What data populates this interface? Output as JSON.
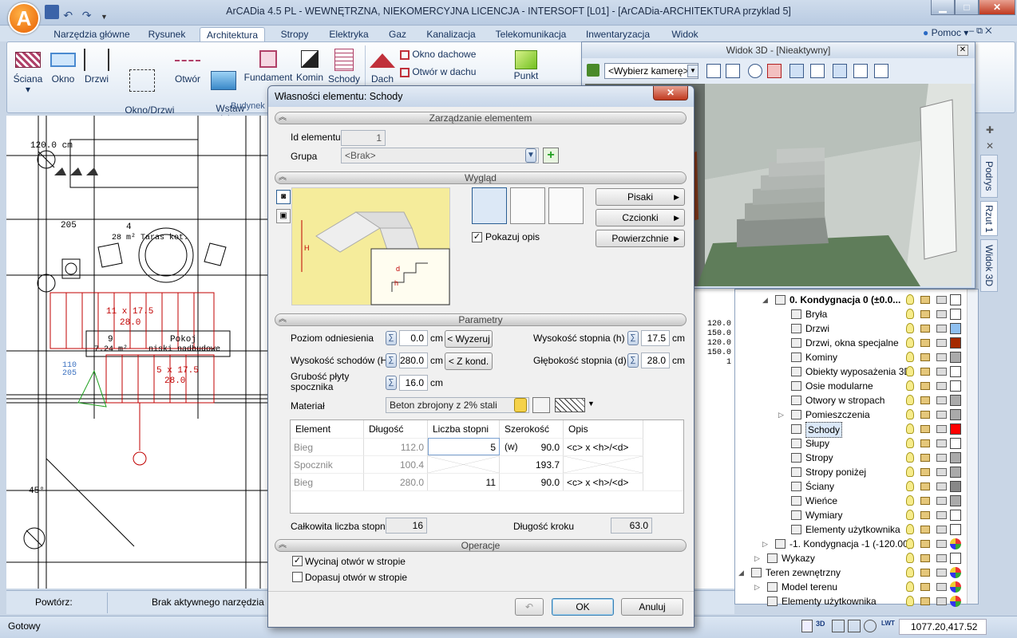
{
  "window": {
    "logo_letter": "A",
    "title": "ArCADia 4.5 PL - WEWNĘTRZNA, NIEKOMERCYJNA LICENCJA - INTERSOFT [L01] - [ArCADia-ARCHITEKTURA przyklad 5]"
  },
  "ribbon_tabs": [
    "Narzędzia główne",
    "Rysunek",
    "Architektura",
    "Stropy",
    "Elektryka",
    "Gaz",
    "Kanalizacja",
    "Telekomunikacja",
    "Inwentaryzacja",
    "Widok"
  ],
  "help_label": "Pomoc",
  "ribbon": {
    "buttons": [
      {
        "label": "Ściana"
      },
      {
        "label": "Okno"
      },
      {
        "label": "Drzwi"
      },
      {
        "label": "Okno/Drzwi\nspecjalne"
      },
      {
        "label": "Otwór"
      },
      {
        "label": "Wstaw\npodciąg"
      },
      {
        "label": "Fundament"
      },
      {
        "label": "Komin"
      },
      {
        "label": "Schody"
      },
      {
        "label": "Dach"
      }
    ],
    "small_buttons": [
      "Okno dachowe",
      "Otwór w dachu"
    ],
    "punkt_label": "Punkt",
    "group_label": "Budynek"
  },
  "view3d": {
    "title": "Widok 3D - [Nieaktywny]",
    "camera_placeholder": "<Wybierz kamerę>"
  },
  "side_tabs": [
    "Podrys",
    "Rzut 1",
    "Widok 3D"
  ],
  "tree": {
    "items": [
      {
        "label": "0. Kondygnacja 0 (±0.0...",
        "bold": true,
        "color": "#ffffff"
      },
      {
        "label": "Bryła",
        "color": "#ffffff"
      },
      {
        "label": "Drzwi",
        "color": "#8fc0f0"
      },
      {
        "label": "Drzwi, okna specjalne",
        "color": "#a52a00"
      },
      {
        "label": "Kominy",
        "color": "#aaaaaa"
      },
      {
        "label": "Obiekty wyposażenia 3D",
        "color": "#ffffff"
      },
      {
        "label": "Osie modularne",
        "color": "#ffffff"
      },
      {
        "label": "Otwory w stropach",
        "color": "#aaaaaa"
      },
      {
        "label": "Pomieszczenia",
        "color": "#aaaaaa"
      },
      {
        "label": "Schody",
        "color": "#ff0000",
        "selected": true
      },
      {
        "label": "Słupy",
        "color": "#ffffff"
      },
      {
        "label": "Stropy",
        "color": "#aaaaaa"
      },
      {
        "label": "Stropy poniżej",
        "color": "#aaaaaa"
      },
      {
        "label": "Ściany",
        "color": "#888888"
      },
      {
        "label": "Wieńce",
        "color": "#aaaaaa"
      },
      {
        "label": "Wymiary",
        "color": "#ffffff"
      },
      {
        "label": "Elementy użytkownika",
        "color": "#ffffff"
      },
      {
        "label": "-1. Kondygnacja -1 (-120.00)",
        "color": "multi"
      },
      {
        "label": "Wykazy",
        "color": "#ffffff"
      },
      {
        "label": "Teren zewnętrzny",
        "color": "multi"
      },
      {
        "label": "Model terenu",
        "color": "multi"
      },
      {
        "label": "Elementy użytkownika",
        "color": "multi"
      }
    ]
  },
  "drawing": {
    "labels": [
      "120.0 cm",
      "205",
      "4",
      "28 m² Taras kot.",
      "11 x 17.5",
      "28.0",
      "9",
      "Pokoj",
      "7.24 m²",
      "niski nadbudowe",
      "110",
      "205",
      "5 x 17.5",
      "28.0",
      "45°"
    ],
    "right_values": [
      "120.0",
      "150.0",
      "120.0",
      "150.0",
      "1"
    ]
  },
  "bottom_bar": {
    "repeat_label": "Powtórz:",
    "tool_status": "Brak aktywnego narzędzia"
  },
  "status": {
    "left": "Gotowy",
    "coords": "1077.20,417.52"
  },
  "dialog": {
    "title": "Własności elementu: Schody",
    "sections": {
      "management": "Zarządzanie elementem",
      "appearance": "Wygląd",
      "parameters": "Parametry",
      "operations": "Operacje"
    },
    "id_label": "Id elementu",
    "id_value": "1",
    "group_label": "Grupa",
    "group_value": "<Brak>",
    "show_desc_label": "Pokazuj opis",
    "show_desc_checked": true,
    "style_buttons": [
      "Pisaki",
      "Czcionki",
      "Powierzchnie"
    ],
    "params": {
      "ref_level_label": "Poziom odniesienia",
      "ref_level_value": "0.0",
      "ref_level_unit": "cm",
      "ref_level_btn": "< Wyzeruj",
      "stairs_height_label": "Wysokość schodów (H)",
      "stairs_height_value": "280.0",
      "stairs_height_unit": "cm",
      "stairs_height_btn": "< Z kond.",
      "slab_label": "Grubość płyty spocznika",
      "slab_value": "16.0",
      "slab_unit": "cm",
      "step_h_label": "Wysokość stopnia (h)",
      "step_h_value": "17.5",
      "step_h_unit": "cm",
      "step_d_label": "Głębokość stopnia (d)",
      "step_d_value": "28.0",
      "step_d_unit": "cm",
      "material_label": "Materiał",
      "material_value": "Beton zbrojony z 2% stali"
    },
    "table": {
      "headers": [
        "Element",
        "Długość",
        "Liczba stopni (c)",
        "Szerokość (w)",
        "Opis"
      ],
      "rows": [
        {
          "element": "Bieg",
          "length": "112.0",
          "steps": "5",
          "width": "90.0",
          "desc": "<c> x <h>/<d>"
        },
        {
          "element": "Spocznik",
          "length": "100.4",
          "steps": "",
          "width": "193.7",
          "desc": ""
        },
        {
          "element": "Bieg",
          "length": "280.0",
          "steps": "11",
          "width": "90.0",
          "desc": "<c> x <h>/<d>"
        }
      ]
    },
    "total_steps_label": "Całkowita liczba stopni",
    "total_steps_value": "16",
    "step_length_label": "Długość kroku",
    "step_length_value": "63.0",
    "op_cut_label": "Wycinaj otwór w stropie",
    "op_cut_checked": true,
    "op_fit_label": "Dopasuj otwór w stropie",
    "op_fit_checked": false,
    "ok_label": "OK",
    "cancel_label": "Anuluj"
  }
}
